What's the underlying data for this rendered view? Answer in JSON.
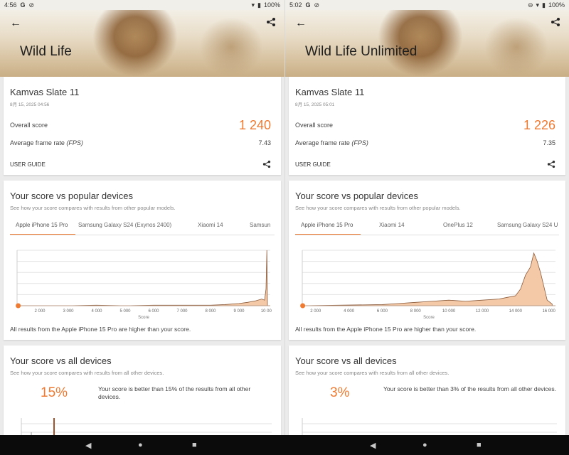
{
  "left": {
    "status": {
      "time": "4:56",
      "icons": [
        "google-icon",
        "dnd-icon"
      ],
      "battery": "100%"
    },
    "header": {
      "title": "Wild Life"
    },
    "summary": {
      "device": "Kamvas Slate 11",
      "date": "8月 15, 2025 04:56",
      "overall_label": "Overall score",
      "overall_value": "1 240",
      "fps_label": "Average frame rate",
      "fps_unit": "(FPS)",
      "fps_value": "7.43",
      "guide": "USER GUIDE"
    },
    "popular": {
      "title": "Your score vs popular devices",
      "subtitle": "See how your score compares with results from other popular models.",
      "tabs": [
        "Apple iPhone 15 Pro",
        "Samsung Galaxy S24 (Exynos 2400)",
        "Xiaomi 14",
        "Samsun"
      ],
      "footnote": "All results from the Apple iPhone 15 Pro are higher than your score.",
      "chart_data": {
        "type": "area",
        "xlabel": "Score",
        "ticks": [
          "2 000",
          "3 000",
          "4 000",
          "5 000",
          "6 000",
          "7 000",
          "8 000",
          "9 000",
          "10 000"
        ],
        "xlim": [
          1200,
          10100
        ],
        "marker_score": 1240,
        "x": [
          1200,
          3000,
          4000,
          5000,
          6000,
          7000,
          8000,
          8500,
          9000,
          9300,
          9600,
          9800,
          9900,
          9950,
          9980,
          10000
        ],
        "y": [
          0.0,
          0.0,
          0.01,
          0.0,
          0.01,
          0.01,
          0.01,
          0.02,
          0.04,
          0.06,
          0.09,
          0.12,
          0.1,
          0.3,
          1.0,
          0.05
        ]
      }
    },
    "all": {
      "title": "Your score vs all devices",
      "subtitle": "See how your score compares with results from all other devices.",
      "percent": "15%",
      "text": "Your score is better than 15% of the results from all other devices."
    }
  },
  "right": {
    "status": {
      "time": "5:02",
      "icons": [
        "google-icon",
        "dnd-icon"
      ],
      "battery": "100%"
    },
    "header": {
      "title": "Wild Life Unlimited"
    },
    "summary": {
      "device": "Kamvas Slate 11",
      "date": "8月 15, 2025 05:01",
      "overall_label": "Overall score",
      "overall_value": "1 226",
      "fps_label": "Average frame rate",
      "fps_unit": "(FPS)",
      "fps_value": "7.35",
      "guide": "USER GUIDE"
    },
    "popular": {
      "title": "Your score vs popular devices",
      "subtitle": "See how your score compares with results from other popular models.",
      "tabs": [
        "Apple iPhone 15 Pro",
        "Xiaomi 14",
        "OnePlus 12",
        "Samsung Galaxy S24 U"
      ],
      "footnote": "All results from the Apple iPhone 15 Pro are higher than your score.",
      "chart_data": {
        "type": "area",
        "xlabel": "Score",
        "ticks": [
          "2 000",
          "4 000",
          "6 000",
          "8 000",
          "10 000",
          "12 000",
          "14 000",
          "16 000"
        ],
        "xlim": [
          1200,
          16400
        ],
        "marker_score": 1226,
        "x": [
          1200,
          6000,
          7000,
          8000,
          9000,
          10000,
          11000,
          12000,
          13000,
          13500,
          14000,
          14300,
          14600,
          14900,
          15100,
          15300,
          15500,
          15700,
          15900,
          16200
        ],
        "y": [
          0.0,
          0.02,
          0.04,
          0.06,
          0.08,
          0.1,
          0.08,
          0.1,
          0.12,
          0.15,
          0.18,
          0.3,
          0.55,
          0.7,
          0.95,
          0.8,
          0.6,
          0.35,
          0.1,
          0.03
        ]
      }
    },
    "all": {
      "title": "Your score vs all devices",
      "subtitle": "See how your score compares with results from all other devices.",
      "percent": "3%",
      "text": "Your score is better than 3% of the results from all other devices."
    }
  },
  "accent_color": "#ef7a32",
  "navbar": {
    "back": "◀",
    "home": "●",
    "recents": "■"
  }
}
